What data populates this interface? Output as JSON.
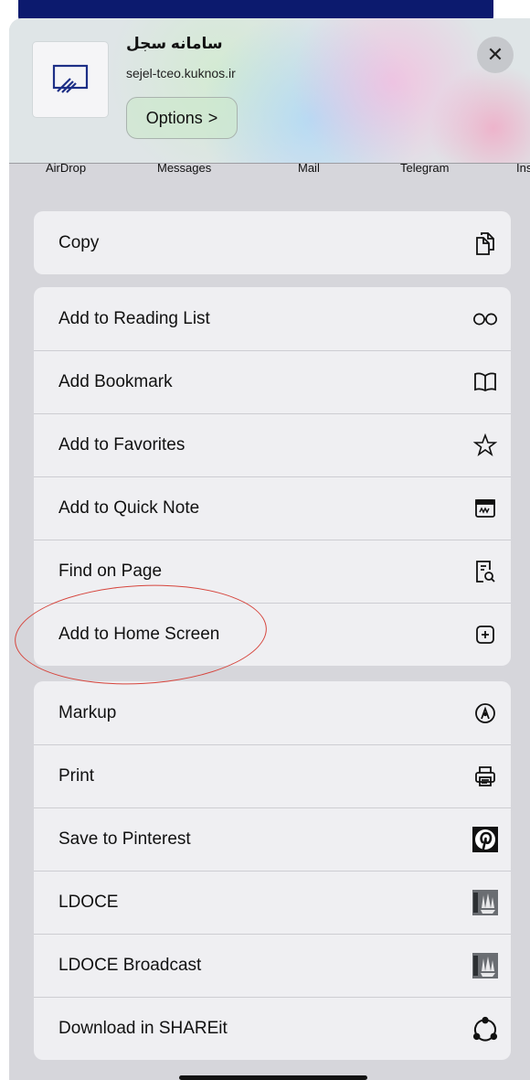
{
  "header": {
    "site_title": "سامانه سجل",
    "site_url": "sejel-tceo.kuknos.ir",
    "options_label": "Options",
    "options_chevron": ">",
    "close_glyph": "✕"
  },
  "share_targets": [
    "AirDrop",
    "Messages",
    "Mail",
    "Telegram",
    "Ins"
  ],
  "groups": [
    {
      "rows": [
        {
          "label": "Copy",
          "icon": "copy-icon"
        }
      ]
    },
    {
      "rows": [
        {
          "label": "Add to Reading List",
          "icon": "glasses-icon"
        },
        {
          "label": "Add Bookmark",
          "icon": "book-icon"
        },
        {
          "label": "Add to Favorites",
          "icon": "star-icon"
        },
        {
          "label": "Add to Quick Note",
          "icon": "quick-note-icon"
        },
        {
          "label": "Find on Page",
          "icon": "find-on-page-icon"
        },
        {
          "label": "Add to Home Screen",
          "icon": "plus-square-icon"
        }
      ]
    },
    {
      "rows": [
        {
          "label": "Markup",
          "icon": "markup-icon"
        },
        {
          "label": "Print",
          "icon": "printer-icon"
        },
        {
          "label": "Save to Pinterest",
          "icon": "pinterest-icon"
        },
        {
          "label": "LDOCE",
          "icon": "longman-icon"
        },
        {
          "label": "LDOCE Broadcast",
          "icon": "longman-icon"
        },
        {
          "label": "Download in SHAREit",
          "icon": "shareit-icon"
        }
      ]
    }
  ],
  "annotation": {
    "highlighted_item": "Add to Home Screen",
    "color": "#d6453d"
  }
}
